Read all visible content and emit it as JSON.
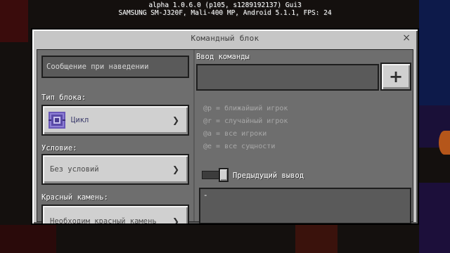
{
  "debug_line1": "alpha 1.0.6.0 (p105, s1289192137) Gui3",
  "debug_line2": "SAMSUNG SM-J320F, Mali-400 MP, Android 5.1.1, FPS: 24",
  "dialog": {
    "title": "Командный блок",
    "close_symbol": "×"
  },
  "left": {
    "hover_placeholder": "Сообщение при наведении",
    "block_type_label": "Тип блока:",
    "block_type_value": "Цикл",
    "condition_label": "Условие:",
    "condition_value": "Без условий",
    "redstone_label": "Красный камень:",
    "redstone_value": "Необходим красный камень"
  },
  "right": {
    "command_label": "Ввод команды",
    "command_value": "",
    "plus_symbol": "+",
    "hints": [
      "@p = ближайший игрок",
      "@r = случайный игрок",
      "@a = все игроки",
      "@e = все сущности"
    ],
    "previous_output_label": "Предыдущий вывод",
    "previous_output_value": "-"
  },
  "colors": {
    "panel": "#c6c6c6",
    "body": "#6e6e6e",
    "block_icon": "#6a58b8"
  },
  "icons": [
    "close-icon",
    "command-block-icon",
    "chevron-right-icon",
    "plus-icon",
    "toggle-switch"
  ]
}
